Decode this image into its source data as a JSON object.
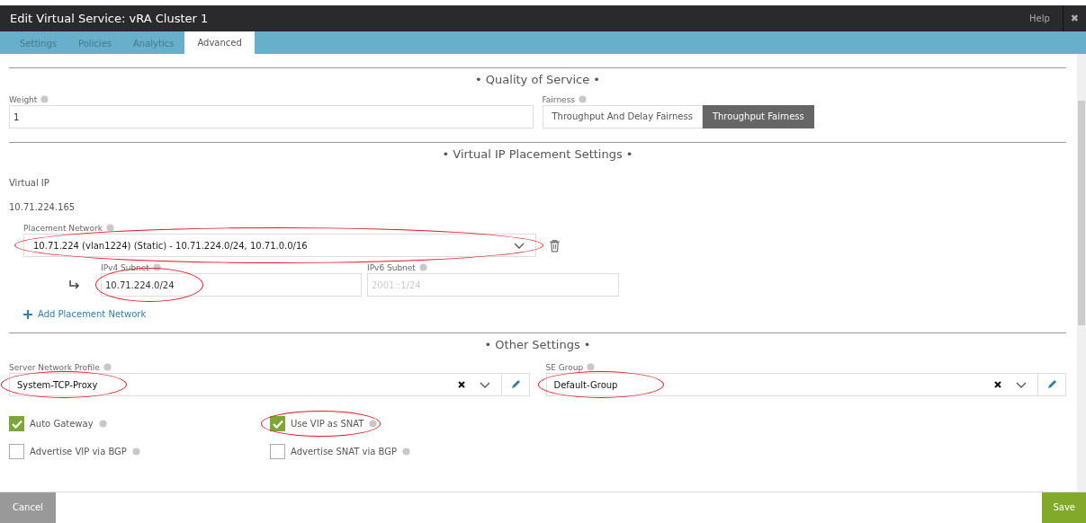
{
  "window": {
    "title": "Edit Virtual Service: vRA Cluster 1",
    "help": "Help",
    "close": "✖"
  },
  "tabs": [
    {
      "label": "Settings",
      "selected": false
    },
    {
      "label": "Policies",
      "selected": false
    },
    {
      "label": "Analytics",
      "selected": false
    },
    {
      "label": "Advanced",
      "selected": true
    }
  ],
  "qos": {
    "heading": "• Quality of Service •",
    "weight": {
      "label": "Weight",
      "value": "1"
    },
    "fairness": {
      "label": "Fairness",
      "options": [
        {
          "label": "Throughput And Delay Fairness",
          "selected": false
        },
        {
          "label": "Throughput Fairness",
          "selected": true
        }
      ]
    }
  },
  "vip": {
    "heading": "• Virtual IP Placement Settings •",
    "label": "Virtual IP",
    "value": "10.71.224.165",
    "placement_network": {
      "label": "Placement Network",
      "value": "10.71.224 (vlan1224) (Static) - 10.71.224.0/24, 10.71.0.0/16",
      "circled": true
    },
    "ipv4": {
      "label": "IPv4 Subnet",
      "value": "10.71.224.0/24",
      "circled": true
    },
    "ipv6": {
      "label": "IPv6 Subnet",
      "placeholder": "2001::1/24"
    },
    "add_link": "Add Placement Network"
  },
  "other": {
    "heading": "• Other Settings •",
    "selects": [
      {
        "label": "Server Network Profile",
        "value": "System-TCP-Proxy",
        "circled": true
      },
      {
        "label": "SE Group",
        "value": "Default-Group",
        "circled": true
      }
    ],
    "checkboxes": [
      {
        "label": "Auto Gateway",
        "checked": true,
        "circled": false
      },
      {
        "label": "Use VIP as SNAT",
        "checked": true,
        "circled": true
      },
      {
        "label": "Advertise VIP via BGP",
        "checked": false,
        "circled": false
      },
      {
        "label": "Advertise SNAT via BGP",
        "checked": false,
        "circled": false
      }
    ]
  },
  "footer": {
    "cancel": "Cancel",
    "save": "Save"
  }
}
